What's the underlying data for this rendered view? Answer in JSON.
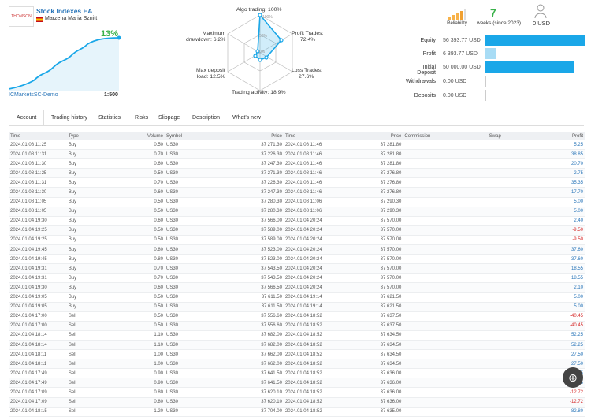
{
  "header": {
    "logo_text": "THOMSON",
    "title": "Stock Indexes EA",
    "author": "Marzena Maria Sznitt",
    "growth": "13%",
    "broker": "ICMarketsSC-Demo",
    "leverage": "1:500"
  },
  "radar": {
    "algo": "Algo trading: 100%",
    "profit_trades_l1": "Profit Trades:",
    "profit_trades_l2": "72.4%",
    "loss_trades_l1": "Loss Trades:",
    "loss_trades_l2": "27.6%",
    "activity": "Trading activity: 18.9%",
    "maxdd_l1": "Maximum",
    "maxdd_l2": "drawdown: 6.2%",
    "maxdep_l1": "Max deposit",
    "maxdep_l2": "load: 12.5%",
    "ring_labels": [
      "100%",
      "50%",
      "0%"
    ]
  },
  "stats": {
    "reliability": "Reliability",
    "weeks_num": "7",
    "weeks_lbl": "weeks (since 2023)",
    "subs": "0 USD",
    "rows": [
      {
        "label": "Equity",
        "value": "56 393.77 USD",
        "fill": 1.0
      },
      {
        "label": "Profit",
        "value": "6 393.77 USD",
        "fill": 0.11
      },
      {
        "label": "Initial Deposit",
        "value": "50 000.00 USD",
        "fill": 0.89
      },
      {
        "label": "Withdrawals",
        "value": "0.00 USD",
        "fill": 0
      },
      {
        "label": "Deposits",
        "value": "0.00 USD",
        "fill": 0
      }
    ]
  },
  "tabs": [
    "Account",
    "Trading history",
    "Statistics",
    "Risks",
    "Slippage",
    "Description",
    "What's new"
  ],
  "table": {
    "headers": [
      "Time",
      "Type",
      "Volume",
      "Symbol",
      "Price",
      "Time",
      "Price",
      "Commission",
      "Swap",
      "Profit"
    ],
    "rows": [
      [
        "2024.01.08 11:25",
        "Buy",
        "0.50",
        "US30",
        "37 271.30",
        "2024.01.08 11:46",
        "37 281.80",
        "",
        "",
        "5.25"
      ],
      [
        "2024.01.08 11:31",
        "Buy",
        "0.70",
        "US30",
        "37 226.30",
        "2024.01.08 11:46",
        "37 281.80",
        "",
        "",
        "38.85"
      ],
      [
        "2024.01.08 11:30",
        "Buy",
        "0.60",
        "US30",
        "37 247.30",
        "2024.01.08 11:46",
        "37 281.80",
        "",
        "",
        "20.70"
      ],
      [
        "2024.01.08 11:25",
        "Buy",
        "0.50",
        "US30",
        "37 271.30",
        "2024.01.08 11:46",
        "37 276.80",
        "",
        "",
        "2.75"
      ],
      [
        "2024.01.08 11:31",
        "Buy",
        "0.70",
        "US30",
        "37 226.30",
        "2024.01.08 11:46",
        "37 276.80",
        "",
        "",
        "35.35"
      ],
      [
        "2024.01.08 11:30",
        "Buy",
        "0.60",
        "US30",
        "37 247.30",
        "2024.01.08 11:46",
        "37 276.80",
        "",
        "",
        "17.70"
      ],
      [
        "2024.01.08 11:05",
        "Buy",
        "0.50",
        "US30",
        "37 280.30",
        "2024.01.08 11:06",
        "37 290.30",
        "",
        "",
        "5.00"
      ],
      [
        "2024.01.08 11:05",
        "Buy",
        "0.50",
        "US30",
        "37 280.30",
        "2024.01.08 11:06",
        "37 290.30",
        "",
        "",
        "5.00"
      ],
      [
        "2024.01.04 19:30",
        "Buy",
        "0.60",
        "US30",
        "37 566.00",
        "2024.01.04 20:24",
        "37 570.00",
        "",
        "",
        "2.40"
      ],
      [
        "2024.01.04 19:25",
        "Buy",
        "0.50",
        "US30",
        "37 589.00",
        "2024.01.04 20:24",
        "37 570.00",
        "",
        "",
        "-9.50"
      ],
      [
        "2024.01.04 19:25",
        "Buy",
        "0.50",
        "US30",
        "37 589.00",
        "2024.01.04 20:24",
        "37 570.00",
        "",
        "",
        "-9.50"
      ],
      [
        "2024.01.04 19:45",
        "Buy",
        "0.80",
        "US30",
        "37 523.00",
        "2024.01.04 20:24",
        "37 570.00",
        "",
        "",
        "37.60"
      ],
      [
        "2024.01.04 19:45",
        "Buy",
        "0.80",
        "US30",
        "37 523.00",
        "2024.01.04 20:24",
        "37 570.00",
        "",
        "",
        "37.60"
      ],
      [
        "2024.01.04 19:31",
        "Buy",
        "0.70",
        "US30",
        "37 543.50",
        "2024.01.04 20:24",
        "37 570.00",
        "",
        "",
        "18.55"
      ],
      [
        "2024.01.04 19:31",
        "Buy",
        "0.70",
        "US30",
        "37 543.50",
        "2024.01.04 20:24",
        "37 570.00",
        "",
        "",
        "18.55"
      ],
      [
        "2024.01.04 19:30",
        "Buy",
        "0.60",
        "US30",
        "37 566.50",
        "2024.01.04 20:24",
        "37 570.00",
        "",
        "",
        "2.10"
      ],
      [
        "2024.01.04 19:05",
        "Buy",
        "0.50",
        "US30",
        "37 611.50",
        "2024.01.04 19:14",
        "37 621.50",
        "",
        "",
        "5.00"
      ],
      [
        "2024.01.04 19:05",
        "Buy",
        "0.50",
        "US30",
        "37 611.50",
        "2024.01.04 19:14",
        "37 621.50",
        "",
        "",
        "5.00"
      ],
      [
        "2024.01.04 17:00",
        "Sell",
        "0.50",
        "US30",
        "37 556.60",
        "2024.01.04 18:52",
        "37 637.50",
        "",
        "",
        "-40.45"
      ],
      [
        "2024.01.04 17:00",
        "Sell",
        "0.50",
        "US30",
        "37 556.60",
        "2024.01.04 18:52",
        "37 637.50",
        "",
        "",
        "-40.45"
      ],
      [
        "2024.01.04 18:14",
        "Sell",
        "1.10",
        "US30",
        "37 682.00",
        "2024.01.04 18:52",
        "37 634.50",
        "",
        "",
        "52.25"
      ],
      [
        "2024.01.04 18:14",
        "Sell",
        "1.10",
        "US30",
        "37 682.00",
        "2024.01.04 18:52",
        "37 634.50",
        "",
        "",
        "52.25"
      ],
      [
        "2024.01.04 18:11",
        "Sell",
        "1.00",
        "US30",
        "37 662.00",
        "2024.01.04 18:52",
        "37 634.50",
        "",
        "",
        "27.50"
      ],
      [
        "2024.01.04 18:11",
        "Sell",
        "1.00",
        "US30",
        "37 662.00",
        "2024.01.04 18:52",
        "37 634.50",
        "",
        "",
        "27.50"
      ],
      [
        "2024.01.04 17:49",
        "Sell",
        "0.90",
        "US30",
        "37 641.50",
        "2024.01.04 18:52",
        "37 636.00",
        "",
        "",
        "4.95"
      ],
      [
        "2024.01.04 17:49",
        "Sell",
        "0.90",
        "US30",
        "37 641.50",
        "2024.01.04 18:52",
        "37 636.00",
        "",
        "",
        "4.95"
      ],
      [
        "2024.01.04 17:09",
        "Sell",
        "0.80",
        "US30",
        "37 620.10",
        "2024.01.04 18:52",
        "37 636.00",
        "",
        "",
        "-12.72"
      ],
      [
        "2024.01.04 17:09",
        "Sell",
        "0.80",
        "US30",
        "37 620.10",
        "2024.01.04 18:52",
        "37 636.00",
        "",
        "",
        "-12.72"
      ],
      [
        "2024.01.04 18:15",
        "Sell",
        "1.20",
        "US30",
        "37 704.00",
        "2024.01.04 18:52",
        "37 635.00",
        "",
        "",
        "82.80"
      ]
    ]
  },
  "colors": {
    "accent": "#1aa7e8",
    "green": "#3ab14a",
    "neg": "#d62b2b",
    "link": "#2a76b9"
  }
}
